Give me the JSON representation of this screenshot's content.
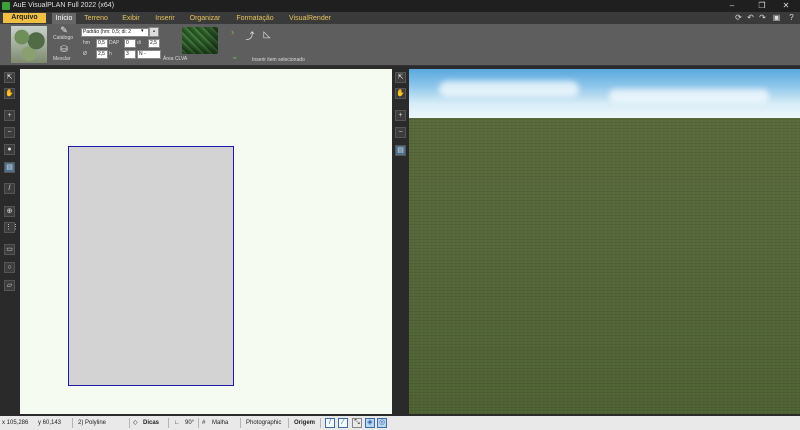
{
  "window": {
    "title": "AuE VisualPLAN Full 2022 (x64)",
    "minimize_icon": "minimize-icon",
    "restore_icon": "restore-icon",
    "close_icon": "close-icon"
  },
  "menu": {
    "file_tab": "Arquivo",
    "tabs": [
      "Início",
      "Terreno",
      "Exibir",
      "Inserir",
      "Organizar",
      "Formatação",
      "VisualRender"
    ],
    "active_tab": "Início",
    "accent_color": "#f1c043"
  },
  "ribbon": {
    "catalog_label": "Catálogo",
    "measure_label": "Mesclar",
    "preset_value": "Padrão (hm: 0,5; di: 2",
    "hm_label": "hm",
    "hm_value": "0,5",
    "dap_label": "DAP",
    "dap_value": "0",
    "di_label": "di",
    "di_value": "2,5",
    "diam_label": "Ø",
    "diam_value": "2,5",
    "h_label": "h",
    "h_value": "3",
    "n_value": "N -",
    "area_label": "Área CLVA",
    "insert_hint": "Inserir item selecionado"
  },
  "statusbar": {
    "x": "x 105,286",
    "y": "y 60,143",
    "mode": "2) Polyline",
    "tips": "Dicas",
    "angle": "90°",
    "grid": "Malha",
    "render": "Photographic",
    "origin": "Origem"
  }
}
